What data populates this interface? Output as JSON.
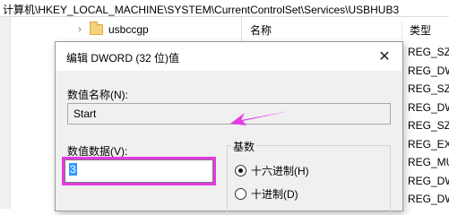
{
  "address_bar": {
    "path": "计算机\\HKEY_LOCAL_MACHINE\\SYSTEM\\CurrentControlSet\\Services\\USBHUB3"
  },
  "tree": {
    "item_label": "usbccgp"
  },
  "list": {
    "header_name": "名称",
    "header_type": "类型",
    "types": [
      "REG_SZ",
      "REG_DW",
      "REG_SZ",
      "REG_DW",
      "REG_SZ",
      "REG_EX",
      "REG_MU",
      "REG_DW",
      "REG_DW"
    ]
  },
  "dialog": {
    "title": "编辑 DWORD (32 位)值",
    "close_glyph": "✕",
    "name_label": "数值名称(N):",
    "name_value": "Start",
    "data_label": "数值数据(V):",
    "data_value": "3",
    "base_label": "基数",
    "radio_hex": "十六进制(H)",
    "radio_dec": "十进制(D)",
    "selected_base": "hex"
  },
  "annotation": {
    "color": "#e33be3"
  }
}
